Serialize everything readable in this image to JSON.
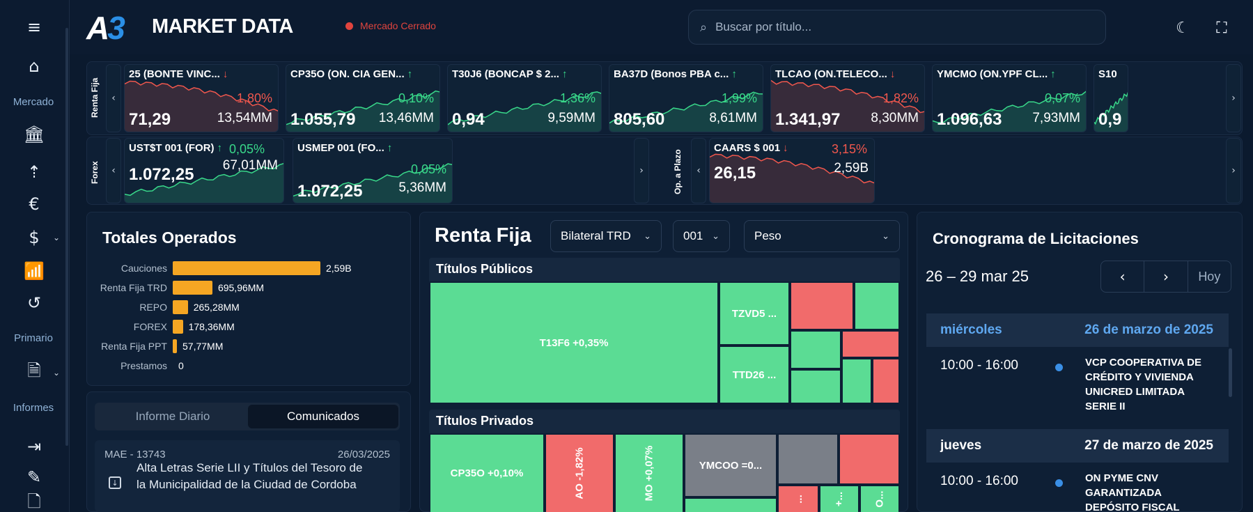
{
  "header": {
    "logo_a": "A",
    "logo_3": "3",
    "logo_text": "MARKET DATA",
    "market_status": "Mercado Cerrado",
    "search_placeholder": "Buscar por título..."
  },
  "sidebar": {
    "labels": {
      "mercado": "Mercado",
      "primario": "Primario",
      "informes": "Informes"
    },
    "icons": [
      "menu-icon",
      "home-icon",
      "bank-icon",
      "sort-icon",
      "euro-icon",
      "dollar-icon",
      "chart-icon",
      "history-icon",
      "document-icon",
      "export-icon",
      "edit-icon",
      "report-icon"
    ]
  },
  "ticker": {
    "renta_fija_label": "Renta Fija",
    "forex_label": "Forex",
    "plazo_label": "Op. a Plazo",
    "renta_fija": [
      {
        "name": "25 (BONTE VINC...",
        "arrow": "↓",
        "pct": "1,80%",
        "price": "71,29",
        "vol": "13,54MM",
        "dir": "down"
      },
      {
        "name": "CP35O (ON. CIA GEN...",
        "arrow": "↑",
        "pct": "0,10%",
        "price": "1.055,79",
        "vol": "13,46MM",
        "dir": "up"
      },
      {
        "name": "T30J6 (BONCAP $ 2...",
        "arrow": "↑",
        "pct": "1,36%",
        "price": "0,94",
        "vol": "9,59MM",
        "dir": "up"
      },
      {
        "name": "BA37D (Bonos PBA c...",
        "arrow": "↑",
        "pct": "1,99%",
        "price": "805,60",
        "vol": "8,61MM",
        "dir": "up"
      },
      {
        "name": "TLCAO (ON.TELECO...",
        "arrow": "↓",
        "pct": "1,82%",
        "price": "1.341,97",
        "vol": "8,30MM",
        "dir": "down"
      },
      {
        "name": "YMCMO (ON.YPF CL...",
        "arrow": "↑",
        "pct": "0,07%",
        "price": "1.096,63",
        "vol": "7,93MM",
        "dir": "up"
      },
      {
        "name": "S10",
        "arrow": "",
        "pct": "",
        "price": "0,9",
        "vol": "",
        "dir": "up"
      }
    ],
    "forex": [
      {
        "name": "UST$T 001 (FOR)",
        "arrow": "↑",
        "pct": "0,05%",
        "price": "1.072,25",
        "vol": "67,01MM",
        "dir": "up"
      },
      {
        "name": "USMEP 001 (FO...",
        "arrow": "↑",
        "pct": "0,05%",
        "price": "1.072,25",
        "vol": "5,36MM",
        "dir": "up"
      }
    ],
    "plazo": [
      {
        "name": "CAARS $ 001",
        "arrow": "↓",
        "pct": "3,15%",
        "price": "26,15",
        "vol": "2,59B",
        "dir": "down"
      }
    ]
  },
  "totales": {
    "title": "Totales Operados",
    "rows": [
      {
        "label": "Cauciones",
        "value": "2,59B",
        "amount": 2590
      },
      {
        "label": "Renta Fija TRD",
        "value": "695,96MM",
        "amount": 695.96
      },
      {
        "label": "REPO",
        "value": "265,28MM",
        "amount": 265.28
      },
      {
        "label": "FOREX",
        "value": "178,36MM",
        "amount": 178.36
      },
      {
        "label": "Renta Fija PPT",
        "value": "57,77MM",
        "amount": 57.77
      },
      {
        "label": "Prestamos",
        "value": "0",
        "amount": 0
      }
    ]
  },
  "informes": {
    "tab_diario": "Informe Diario",
    "tab_comunicados": "Comunicados",
    "item": {
      "code": "MAE - 13743",
      "date": "26/03/2025",
      "text": "Alta Letras Serie LII y Títulos del Tesoro de la Municipalidad de la Ciudad de Cordoba"
    }
  },
  "renta_fija": {
    "title": "Renta Fija",
    "select_market": "Bilateral TRD",
    "select_plazo": "001",
    "select_moneda": "Peso",
    "publicos_title": "Títulos Públicos",
    "privados_title": "Títulos Privados",
    "tiles": {
      "t13f6": "T13F6 +0,35%",
      "tzvd5": "TZVD5 ...",
      "ttd26": "TTD26 ...",
      "cp35o": "CP35O +0,10%",
      "tlcao_v": "AO -1,82%",
      "ymcmo_v": "MO +0,07%",
      "ymcoo": "YMCOO =0...",
      "small1": "...",
      "small2": "+...",
      "small3": "O..."
    }
  },
  "cronograma": {
    "title": "Cronograma de Licitaciones",
    "range": "26 – 29 mar 25",
    "prev": "‹",
    "next": "›",
    "today": "Hoy",
    "days": [
      {
        "weekday": "miércoles",
        "date": "26 de marzo de 2025",
        "events": [
          {
            "time": "10:00 - 16:00",
            "title": "VCP COOPERATIVA DE CRÉDITO Y VIVIENDA UNICRED LIMITADA SERIE II"
          }
        ]
      },
      {
        "weekday": "jueves",
        "date": "27 de marzo de 2025",
        "events": [
          {
            "time": "10:00 - 16:00",
            "title": "ON PYME CNV GARANTIZADA DEPÓSITO FISCAL"
          }
        ]
      }
    ]
  },
  "colors": {
    "up": "#39d98a",
    "down": "#f0574d",
    "accent": "#2b8fe6",
    "bar": "#f5a623",
    "bg": "#0b1a2e"
  }
}
